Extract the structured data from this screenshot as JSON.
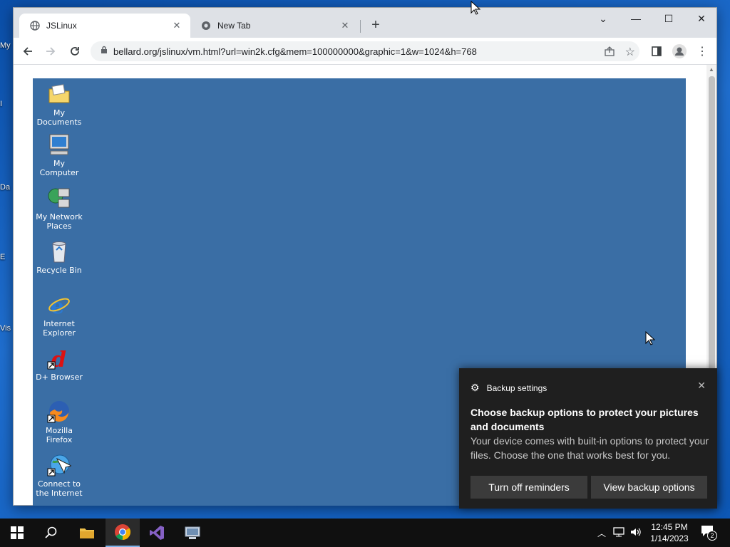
{
  "host": {
    "desktop_stubs": [
      "My",
      "I",
      "Da",
      "E",
      "Vis"
    ]
  },
  "browser": {
    "tabs": [
      {
        "label": "JSLinux",
        "icon": "globe-icon",
        "active": true
      },
      {
        "label": "New Tab",
        "icon": "chrome-icon",
        "active": false
      }
    ],
    "url": "bellard.org/jslinux/vm.html?url=win2k.cfg&mem=100000000&graphic=1&w=1024&h=768"
  },
  "vm_desktop": {
    "icons": [
      {
        "label": "My Documents",
        "icon": "folder-icon"
      },
      {
        "label": "My Computer",
        "icon": "computer-icon"
      },
      {
        "label": "My Network Places",
        "icon": "network-icon"
      },
      {
        "label": "Recycle Bin",
        "icon": "recycle-bin-icon"
      },
      {
        "label": "Internet Explorer",
        "icon": "internet-explorer-icon"
      },
      {
        "label": "D+ Browser",
        "icon": "d-plus-browser-icon"
      },
      {
        "label": "Mozilla Firefox",
        "icon": "firefox-icon"
      },
      {
        "label": "Connect to the Internet",
        "icon": "connect-internet-icon"
      }
    ]
  },
  "notification": {
    "app": "Backup settings",
    "heading": "Choose backup options to protect your pictures and documents",
    "body": "Your device comes with built-in options to protect your files. Choose the one that works best for you.",
    "buttons": [
      "Turn off reminders",
      "View backup options"
    ]
  },
  "taskbar": {
    "time": "12:45 PM",
    "date": "1/14/2023",
    "notification_count": "2"
  },
  "colors": {
    "vm_desktop": "#3a6ea5",
    "toast_bg": "#1f1f1f",
    "taskbar_bg": "#101010"
  }
}
